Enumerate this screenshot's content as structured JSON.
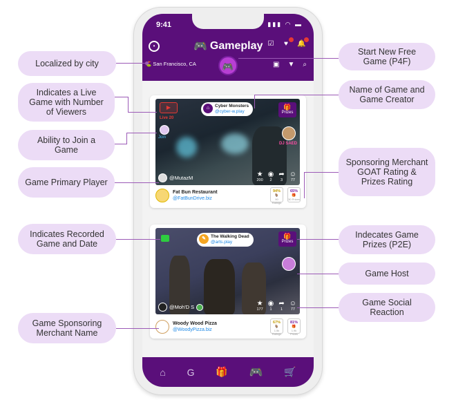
{
  "callouts": {
    "localized": "Localized by city",
    "live": "Indicates a Live Game with Number of Viewers",
    "join": "Ability to Join a Game",
    "primary": "Game Primary Player",
    "recorded": "Indicates Recorded Game and Date",
    "sponsor_name": "Game Sponsoring Merchant Name",
    "start": "Start New Free Game (P4F)",
    "name_creator": "Name of Game and Game Creator",
    "goat": "Sponsoring Merchant GOAT Rating & Prizes Rating",
    "prizes": "Indecates Game Prizes (P2E)",
    "host": "Game Host",
    "social": "Game Social Reaction"
  },
  "status": {
    "time": "9:41",
    "icons": "▮▮▮ ◠ ▬"
  },
  "header": {
    "title": "Gameplay",
    "pad_glyph": "🎮",
    "city": "San Francisco, CA",
    "start_glyph": "🎮",
    "icons": [
      "check-box-icon",
      "heart-icon",
      "bell-icon"
    ]
  },
  "games": [
    {
      "title": "Cyber Monsters",
      "creator": "@cyber-w.play",
      "prizes_label": "Prizes",
      "live_label": "Live 20",
      "join_label": "Join",
      "host_label": "DJ SAED",
      "player": "@MutazM",
      "stats": [
        "200",
        "2",
        "3",
        "77"
      ],
      "merchant": "Fat Bun Restaurant",
      "merchant_handle": "@FatBunDrive.biz",
      "rating_goat": "94%",
      "rating_goat_label": "90 Ratings",
      "rating_prize": "65%",
      "rating_prize_label": "30 Prizes"
    },
    {
      "title": "The Walking Dead",
      "creator": "@arts.play",
      "prizes_label": "Prizes",
      "player": "@Moh'D S",
      "stats": [
        "177",
        "1",
        "1",
        "77"
      ],
      "merchant": "Woody Wood Pizza",
      "merchant_handle": "@WoodyPizza.biz",
      "rating_goat": "67%",
      "rating_goat_label": "1.5k Ratings",
      "rating_prize": "81%",
      "rating_prize_label": "1.9k Prizes"
    }
  ],
  "nav": [
    "⌂",
    "G",
    "🎁",
    "🎮",
    "🛒"
  ]
}
